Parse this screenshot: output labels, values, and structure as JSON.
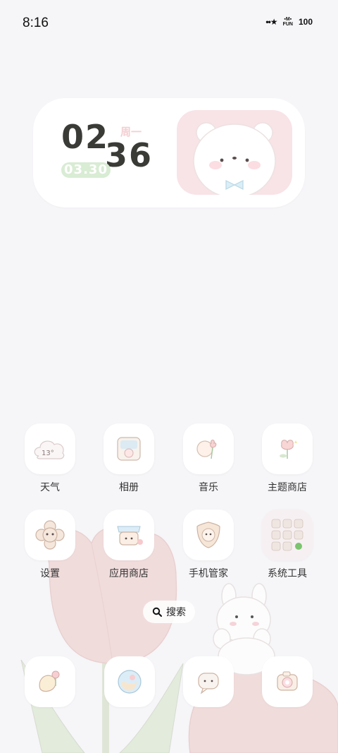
{
  "status_bar": {
    "time": "8:16",
    "carrier_label": "FUN",
    "battery": "100"
  },
  "clock_widget": {
    "hour": "02",
    "minute": "36",
    "weekday": "周一",
    "date": "03.30"
  },
  "apps": [
    {
      "label": "天气",
      "icon": "weather-cloud-icon",
      "temp": "13°"
    },
    {
      "label": "相册",
      "icon": "photo-album-icon"
    },
    {
      "label": "音乐",
      "icon": "music-tulip-icon"
    },
    {
      "label": "主题商店",
      "icon": "theme-store-flower-icon"
    },
    {
      "label": "设置",
      "icon": "settings-bear-flower-icon"
    },
    {
      "label": "应用商店",
      "icon": "app-store-bear-icon"
    },
    {
      "label": "手机管家",
      "icon": "phone-manager-shield-icon"
    },
    {
      "label": "系统工具",
      "icon": "system-tools-folder-icon"
    }
  ],
  "search": {
    "label": "搜索"
  },
  "dock": [
    {
      "icon": "phone-bear-icon"
    },
    {
      "icon": "browser-globe-icon"
    },
    {
      "icon": "messages-bubble-icon"
    },
    {
      "icon": "camera-icon"
    }
  ],
  "colors": {
    "background": "#f6f5f8",
    "clock_text": "#3a3a36",
    "weekday": "#f3cfd3",
    "date_pill": "#d9ecd4",
    "bear_card": "#f8e3e7"
  }
}
